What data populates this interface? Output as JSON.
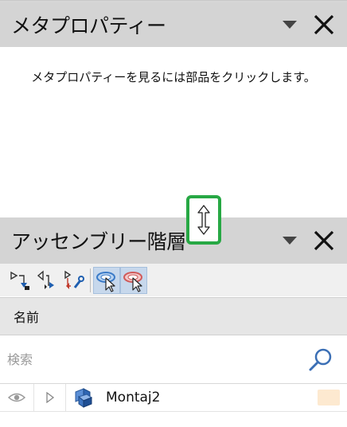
{
  "meta_panel": {
    "title": "メタプロパティー",
    "message": "メタプロパティーを見るには部品をクリックします。"
  },
  "assembly_panel": {
    "title": "アッセンブリー階層",
    "column_header": "名前",
    "search": {
      "placeholder": "検索",
      "value": ""
    },
    "tree": [
      {
        "name": "Montaj2",
        "state_color": "#fde9d0"
      }
    ]
  },
  "colors": {
    "header_bg": "#d4d4d4",
    "splitter_highlight": "#27a844",
    "toolbar_bg": "#f0f0f0",
    "active_button_bg": "#c7d8ec"
  },
  "icons": {
    "header_dropdown": "triangle-down-icon",
    "header_close": "close-icon",
    "splitter": "resize-vertical-icon",
    "toolbar": [
      "expand-all-icon",
      "collapse-all-icon",
      "settings-tree-icon",
      "select-mode-icon",
      "deselect-mode-icon"
    ],
    "row": [
      "eye-icon",
      "expand-arrow-icon",
      "assembly-icon"
    ],
    "search": "magnifier-icon"
  }
}
